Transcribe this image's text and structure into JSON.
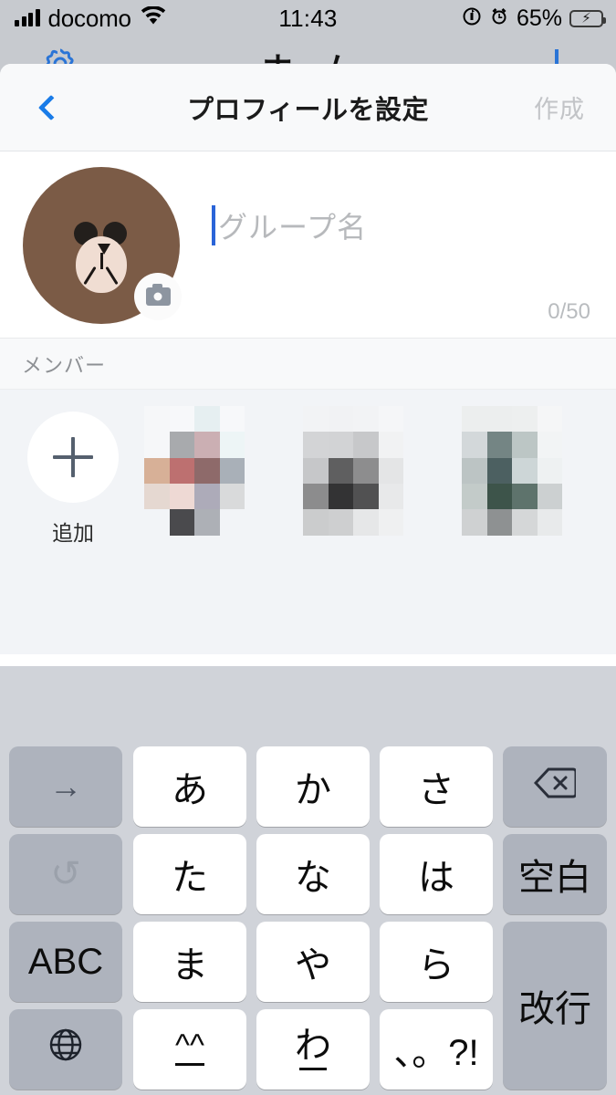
{
  "status_bar": {
    "carrier": "docomo",
    "time": "11:43",
    "battery_percent": "65%",
    "icons": [
      "signal-bars",
      "wifi-icon",
      "rotation-lock-icon",
      "alarm-icon",
      "battery-charging-icon"
    ]
  },
  "background_screen": {
    "title": "ホーム",
    "gear_icon": "gear-icon"
  },
  "navbar": {
    "back": "back-chevron",
    "title": "プロフィールを設定",
    "action_label": "作成",
    "action_enabled": false
  },
  "profile": {
    "avatar_alt": "brown-bear-avatar",
    "camera_badge": "camera-icon",
    "name_placeholder": "グループ名",
    "name_value": "",
    "counter": "0/50"
  },
  "members_section": {
    "header": "メンバー",
    "add_label": "追加",
    "member_avatars": [
      {
        "name": "member-avatar-1",
        "tiles": [
          "#f6f7f9",
          "#f7f8fa",
          "#e6eff1",
          "#f7f8fa",
          "#f6f7f9",
          "#a8aaad",
          "#cbafb3",
          "#edf5f6",
          "#d7b097",
          "#bd7070",
          "#8e6a6a",
          "#a9b0b8",
          "#e5d8d1",
          "#eed9d4",
          "#adabb9",
          "#d9dadb",
          "#f2f4f7",
          "#4a4a4d",
          "#adb0b6",
          "#f2f4f7",
          "#f2f4f7",
          "#f2f4f7",
          "#f2f4f7",
          "#f2f4f7"
        ]
      },
      {
        "name": "member-avatar-2",
        "tiles": [
          "#f2f3f5",
          "#f1f2f4",
          "#f2f3f5",
          "#f5f6f8",
          "#d3d4d6",
          "#d2d3d5",
          "#c7c8ca",
          "#f1f2f3",
          "#c6c7c9",
          "#5f5f60",
          "#8d8d8e",
          "#e4e5e6",
          "#8c8c8d",
          "#333334",
          "#515152",
          "#e8e9ea",
          "#cbcccd",
          "#cecfd0",
          "#e6e7e8",
          "#eff0f1",
          "#f2f4f7",
          "#f2f4f7",
          "#f2f4f7",
          "#f2f4f7"
        ]
      },
      {
        "name": "member-avatar-3",
        "tiles": [
          "#eceeee",
          "#eceeee",
          "#edefef",
          "#f5f6f7",
          "#d3d8da",
          "#748584",
          "#bcc6c5",
          "#f2f4f5",
          "#bcc4c4",
          "#4c6061",
          "#cdd6d7",
          "#eef1f2",
          "#c3cbc9",
          "#3d544a",
          "#5e736c",
          "#ccd0d1",
          "#cfd1d2",
          "#8e9192",
          "#d5d7d8",
          "#e8eaeb",
          "#f2f4f7",
          "#f2f4f7",
          "#f2f4f7",
          "#f2f4f7"
        ]
      }
    ]
  },
  "keyboard": {
    "predictive_text": "",
    "rows": [
      [
        {
          "name": "key-cursor-right",
          "label": "→",
          "type": "fn"
        },
        {
          "name": "key-a-row",
          "label": "あ",
          "type": "char"
        },
        {
          "name": "key-ka-row",
          "label": "か",
          "type": "char"
        },
        {
          "name": "key-sa-row",
          "label": "さ",
          "type": "char"
        },
        {
          "name": "key-backspace",
          "label": "⌫",
          "type": "fn"
        }
      ],
      [
        {
          "name": "key-undo",
          "label": "↺",
          "type": "fn"
        },
        {
          "name": "key-ta-row",
          "label": "た",
          "type": "char"
        },
        {
          "name": "key-na-row",
          "label": "な",
          "type": "char"
        },
        {
          "name": "key-ha-row",
          "label": "は",
          "type": "char"
        },
        {
          "name": "key-space",
          "label": "空白",
          "type": "fn"
        }
      ],
      [
        {
          "name": "key-abc-mode",
          "label": "ABC",
          "type": "fn"
        },
        {
          "name": "key-ma-row",
          "label": "ま",
          "type": "char"
        },
        {
          "name": "key-ya-row",
          "label": "や",
          "type": "char"
        },
        {
          "name": "key-ra-row",
          "label": "ら",
          "type": "char"
        },
        {
          "name": "key-return",
          "label": "改行",
          "type": "fn"
        }
      ],
      [
        {
          "name": "key-globe",
          "label": "🌐",
          "type": "fn"
        },
        {
          "name": "key-kaomoji",
          "label": "^^",
          "type": "char"
        },
        {
          "name": "key-wa-row",
          "label": "わ",
          "type": "char"
        },
        {
          "name": "key-punctuation",
          "label": "、。?!",
          "type": "char"
        }
      ]
    ]
  },
  "colors": {
    "accent_blue": "#1a7ce8",
    "caret_blue": "#2a64d8",
    "avatar_brown": "#7b5b46",
    "keyboard_bg": "#d0d3d9",
    "key_gray": "#aeb3bd",
    "disabled_gray": "#c2c4c7",
    "battery_green": "#4cd764"
  }
}
